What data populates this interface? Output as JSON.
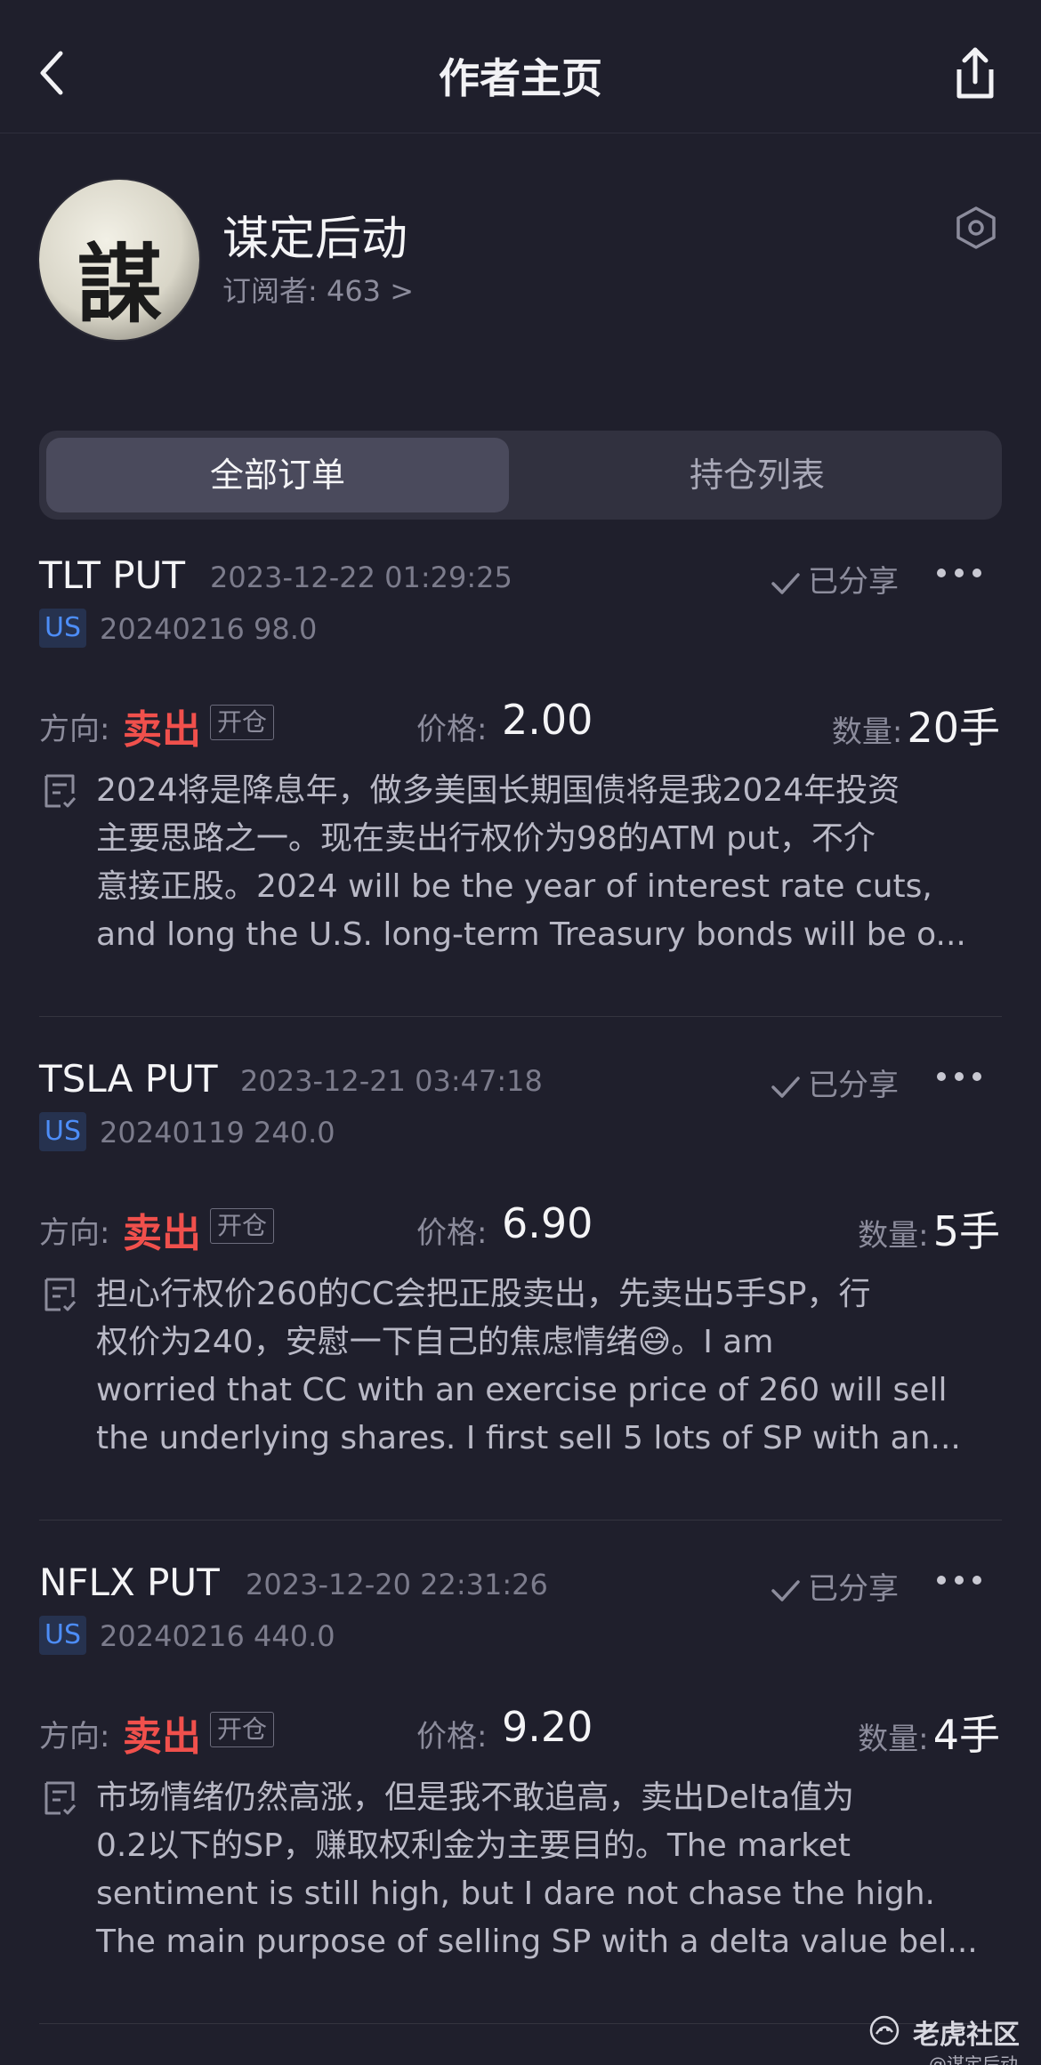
{
  "header": {
    "title": "作者主页",
    "back_icon": "chevron-left-icon",
    "share_icon": "share-icon"
  },
  "author": {
    "avatar_glyph": "謀",
    "name": "谋定后动",
    "subscribers": "订阅者: 463 >",
    "settings_icon": "hexagon-settings-icon"
  },
  "tabs": [
    "全部订单",
    "持仓列表"
  ],
  "orders": [
    {
      "symbol": "TLT PUT",
      "time": "2023-12-22 01:29:25",
      "shared": "已分享",
      "market": "US",
      "contract": "20240216 98.0",
      "direction_label": "方向:",
      "direction": "卖出",
      "tag": "开仓",
      "price_label": "价格:",
      "price": "2.00",
      "qty_label": "数量:",
      "qty": "20手",
      "note": "2024将是降息年，做多美国长期国债将是我2024年投资\n主要思路之一。现在卖出行权价为98的ATM put，不介\n意接正股。2024 will be the year of interest rate cuts,\nand long the U.S. long-term Treasury bonds will be o..."
    },
    {
      "symbol": "TSLA PUT",
      "time": "2023-12-21 03:47:18",
      "shared": "已分享",
      "market": "US",
      "contract": "20240119 240.0",
      "direction_label": "方向:",
      "direction": "卖出",
      "tag": "开仓",
      "price_label": "价格:",
      "price": "6.90",
      "qty_label": "数量:",
      "qty": "5手",
      "note": "担心行权价260的CC会把正股卖出，先卖出5手SP，行\n权价为240，安慰一下自己的焦虑情绪😅。I am\nworried that CC with an exercise price of 260 will sell\nthe underlying shares. I first sell 5 lots of SP with an..."
    },
    {
      "symbol": "NFLX PUT",
      "time": "2023-12-20 22:31:26",
      "shared": "已分享",
      "market": "US",
      "contract": "20240216 440.0",
      "direction_label": "方向:",
      "direction": "卖出",
      "tag": "开仓",
      "price_label": "价格:",
      "price": "9.20",
      "qty_label": "数量:",
      "qty": "4手",
      "note": "市场情绪仍然高涨，但是我不敢追高，卖出Delta值为\n0.2以下的SP，赚取权利金为主要目的。The market\nsentiment is still high, but I dare not chase the high.\nThe main purpose of selling SP with a delta value bel..."
    }
  ],
  "watermark": {
    "brand": "老虎社区",
    "user": "@谋定后动"
  },
  "colors": {
    "background": "#1f1f2c",
    "sell": "#f0504c",
    "market_badge": "#4d8df7",
    "tab_active": "#4a4a5c"
  }
}
